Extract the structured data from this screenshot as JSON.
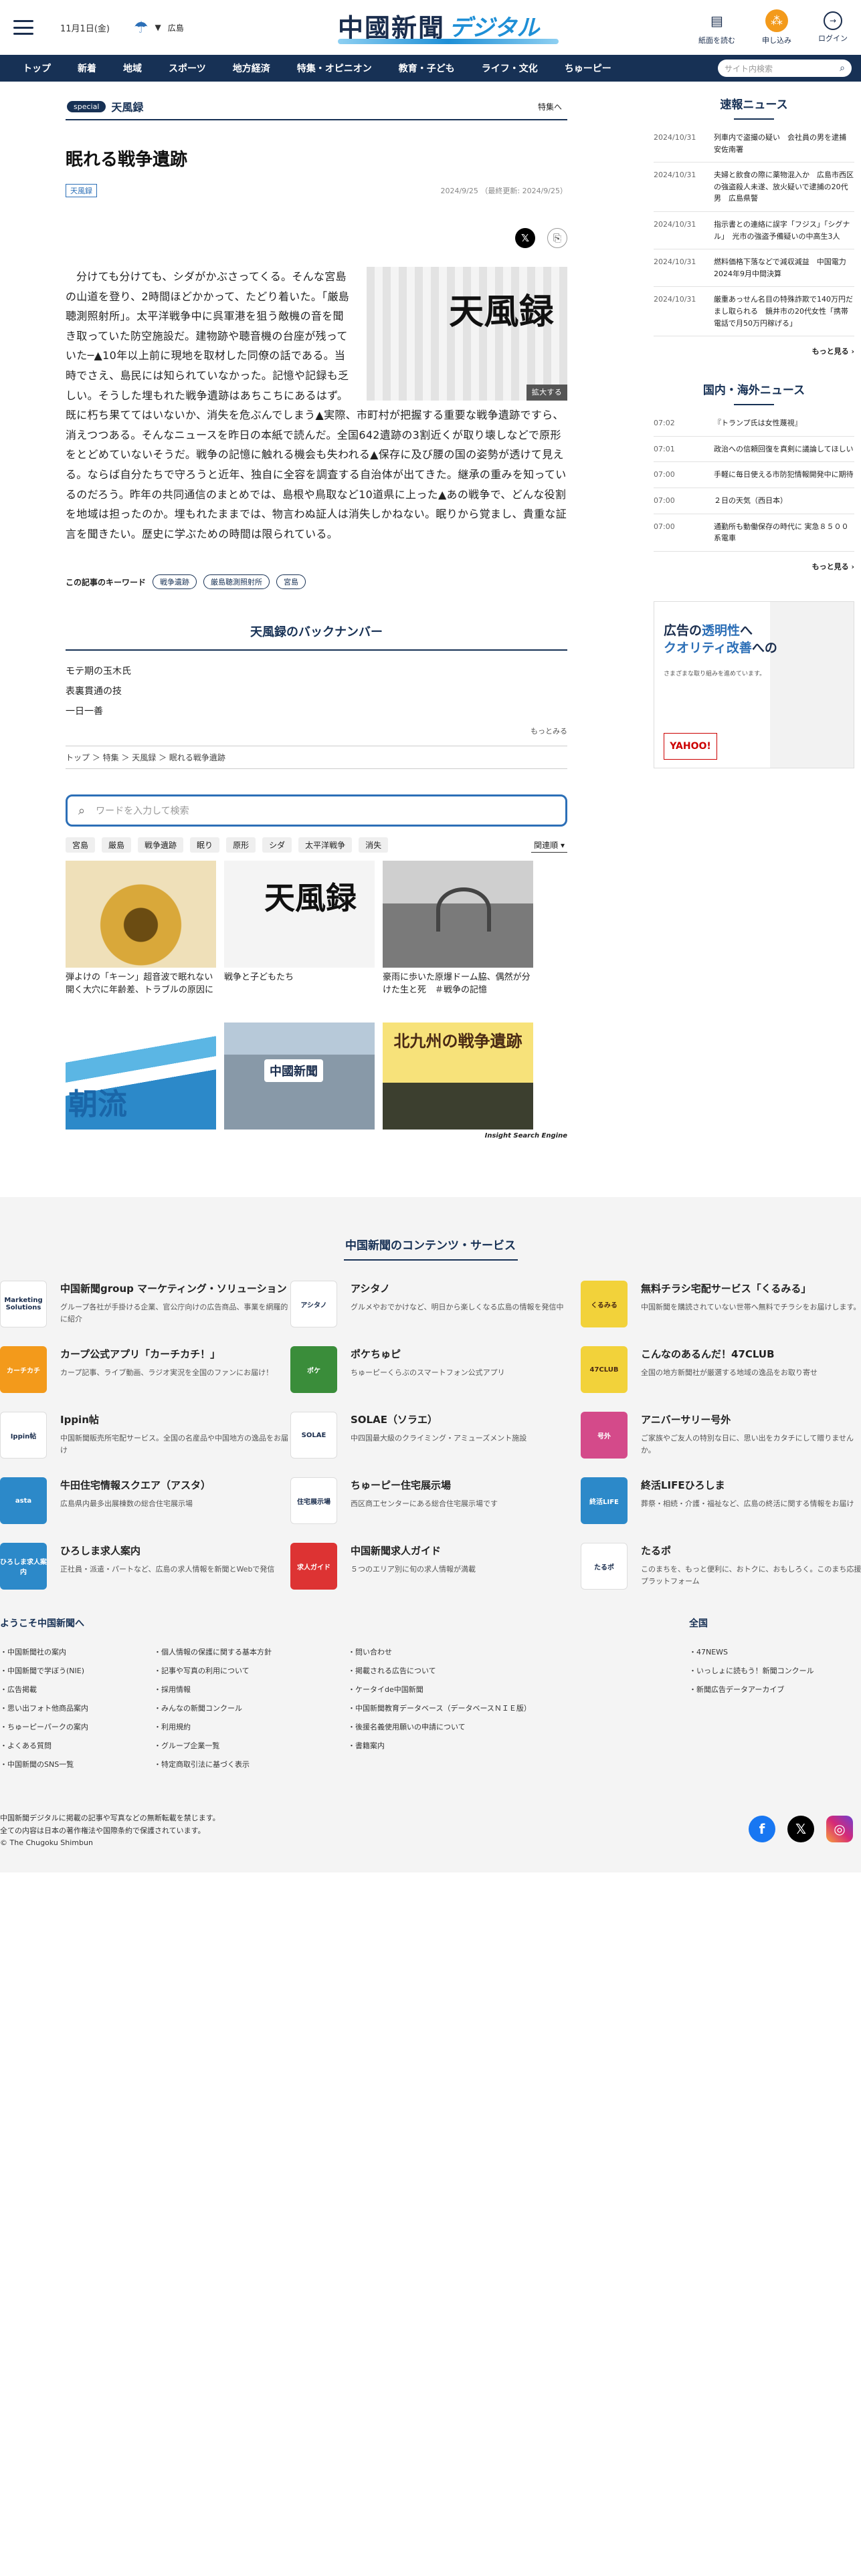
{
  "header": {
    "date": "11月1日(金)",
    "weather_region": "広島",
    "logo_main": "中國新聞",
    "logo_sub": "デジタル",
    "buttons": [
      "紙面を読む",
      "申し込み",
      "ログイン"
    ]
  },
  "nav": {
    "items": [
      "トップ",
      "新着",
      "地域",
      "スポーツ",
      "地方経済",
      "特集・オピニオン",
      "教育・子ども",
      "ライフ・文化",
      "ちゅーピー"
    ],
    "search_placeholder": "サイト内検索"
  },
  "section": {
    "badge": "special",
    "name": "天風録",
    "link": "特集へ"
  },
  "article": {
    "title": "眠れる戦争遺跡",
    "tag": "天風録",
    "dates": "2024/9/25 （最終更新: 2024/9/25）",
    "figure_text": "天風録",
    "figure_enlarge": "拡大する",
    "body": "分けても分けても、シダがかぶさってくる。そんな宮島の山道を登り、2時間ほどかかって、たどり着いた。「厳島聴測照射所」。太平洋戦争中に呉軍港を狙う敵機の音を聞き取っていた防空施設だ。建物跡や聴音機の台座が残っていた─▲10年以上前に現地を取材した同僚の話である。当時でさえ、島民には知られていなかった。記憶や記録も乏しい。そうした埋もれた戦争遺跡はあちこちにあるはず。既に朽ち果ててはいないか、消失を危ぶんでしまう▲実際、市町村が把握する重要な戦争遺跡ですら、消えつつある。そんなニュースを昨日の本紙で読んだ。全国642遺跡の3割近くが取り壊しなどで原形をとどめていないそうだ。戦争の記憶に触れる機会も失われる▲保存に及び腰の国の姿勢が透けて見える。ならば自分たちで守ろうと近年、独自に全容を調査する自治体が出てきた。継承の重みを知っているのだろう。昨年の共同通信のまとめでは、島根や鳥取など10道県に上った▲あの戦争で、どんな役割を地域は担ったのか。埋もれたままでは、物言わぬ証人は消失しかねない。眠りから覚まし、貴重な証言を聞きたい。歴史に学ぶための時間は限られている。",
    "keyword_label": "この記事のキーワード",
    "keywords": [
      "戦争遺跡",
      "厳島聴測照射所",
      "宮島"
    ]
  },
  "backnumber": {
    "title": "天風録のバックナンバー",
    "items": [
      "モテ期の玉木氏",
      "表裏貫通の技",
      "一日一善"
    ],
    "more": "もっとみる"
  },
  "breadcrumb": "トップ ＞ 特集 ＞ 天風録 ＞ 眠れる戦争遺跡",
  "search": {
    "placeholder": "ワードを入力して検索",
    "chips": [
      "宮島",
      "厳島",
      "戦争遺跡",
      "眠り",
      "原形",
      "シダ",
      "太平洋戦争",
      "消失"
    ],
    "sort": "関連順"
  },
  "related": [
    {
      "caption": "弾よけの「キーン」超音波で眠れない　開く大穴に年齢差、トラブルの原因に",
      "img": "img-tube"
    },
    {
      "caption": "戦争と子どもたち",
      "img": "img-text",
      "img_text": "天風録"
    },
    {
      "caption": "豪雨に歩いた原爆ドーム脇、偶然が分けた生と死　＃戦争の記憶",
      "img": "img-dome"
    },
    {
      "caption": "",
      "img": "img-wave",
      "img_text": "朝流"
    },
    {
      "caption": "",
      "img": "img-city",
      "img_text": "中國新聞"
    },
    {
      "caption": "",
      "img": "img-poster",
      "img_text": "北九州の戦争遺跡"
    }
  ],
  "ise": "Insight Search Engine",
  "sidebar": {
    "breaking_title": "速報ニュース",
    "breaking": [
      {
        "date": "2024/10/31",
        "text": "列車内で盗撮の疑い　会社員の男を逮捕　安佐南署"
      },
      {
        "date": "2024/10/31",
        "text": "夫婦と飲食の際に薬物混入か　広島市西区の強盗殺人未遂、放火疑いで逮捕の20代男　広島県警"
      },
      {
        "date": "2024/10/31",
        "text": "指示書との連絡に誤字「フジス」「シグナル」　光市の強盗予備疑いの中高生3人"
      },
      {
        "date": "2024/10/31",
        "text": "燃料価格下落などで減収減益　中国電力　2024年9月中間決算"
      },
      {
        "date": "2024/10/31",
        "text": "厳重あっせん名目の特殊詐欺で140万円だまし取られる　鏡井市の20代女性「携帯電話で月50万円稼げる」"
      }
    ],
    "more": "もっと見る",
    "world_title": "国内・海外ニュース",
    "world": [
      {
        "date": "07:02",
        "text": "『トランプ氏は女性蔑視』"
      },
      {
        "date": "07:01",
        "text": "政治への信頼回復を真剣に議論してほしい"
      },
      {
        "date": "07:00",
        "text": "手軽に毎日使える市防犯情報開発中に期待"
      },
      {
        "date": "07:00",
        "text": "２日の天気（西日本）"
      },
      {
        "date": "07:00",
        "text": "通勤所も動働保存の時代に 実急８５００系電車"
      }
    ],
    "ad": {
      "line1a": "広告の",
      "line1b": "透明性",
      "line1c": "へ",
      "line2a": "クオリティ",
      "line2b": "改善",
      "line2c": "への",
      "small": "さまざまな取り組みを進めています。",
      "logo": "YAHOO!"
    }
  },
  "footer": {
    "title": "中国新聞のコンテンツ・サービス",
    "services": [
      {
        "name": "中国新聞group マーケティング・ソリューション",
        "desc": "グループ各社が手掛ける企業、官公庁向けの広告商品、事業を網羅的に紹介",
        "logo": "Marketing Solutions",
        "cls": "lg-white"
      },
      {
        "name": "アシタノ",
        "desc": "グルメやおでかけなど、明日から楽しくなる広島の情報を発信中",
        "logo": "アシタノ",
        "cls": "lg-white"
      },
      {
        "name": "無料チラシ宅配サービス「くるみる」",
        "desc": "中国新聞を購読されていない世帯へ無料でチラシをお届けします。",
        "logo": "くるみる",
        "cls": "lg-yellow"
      },
      {
        "name": "カープ公式アプリ「カーチカチ！」",
        "desc": "カープ記事、ライブ動画、ラジオ実況を全国のファンにお届け！",
        "logo": "カーチカチ",
        "cls": "lg-orange"
      },
      {
        "name": "ポケちゅピ",
        "desc": "ちゅーピーくらぶのスマートフォン公式アプリ",
        "logo": "ポケ",
        "cls": "lg-green"
      },
      {
        "name": "こんなのあるんだ！47CLUB",
        "desc": "全国の地方新聞社が厳選する地域の逸品をお取り寄せ",
        "logo": "47CLUB",
        "cls": "lg-yellow"
      },
      {
        "name": "Ippin帖",
        "desc": "中国新聞販売所宅配サービス。全国の名産品や中国地方の逸品をお届け",
        "logo": "Ippin帖",
        "cls": "lg-white"
      },
      {
        "name": "SOLAE（ソラエ）",
        "desc": "中四国最大級のクライミング・アミューズメント施設",
        "logo": "SOLAE",
        "cls": "lg-white"
      },
      {
        "name": "アニバーサリー号外",
        "desc": "ご家族やご友人の特別な日に、思い出をカタチにして贈りませんか。",
        "logo": "号外",
        "cls": "lg-pink"
      },
      {
        "name": "牛田住宅情報スクエア（アスタ）",
        "desc": "広島県内最多出展棟数の総合住宅展示場",
        "logo": "asta",
        "cls": "lg-blue"
      },
      {
        "name": "ちゅーピー住宅展示場",
        "desc": "西区商工センターにある総合住宅展示場です",
        "logo": "住宅展示場",
        "cls": "lg-white"
      },
      {
        "name": "終活LIFEひろしま",
        "desc": "葬祭・相続・介護・福祉など、広島の終活に関する情報をお届け",
        "logo": "終活LIFE",
        "cls": "lg-blue"
      },
      {
        "name": "ひろしま求人案内",
        "desc": "正社員・派遣・パートなど、広島の求人情報を新聞とWebで発信",
        "logo": "ひろしま求人案内",
        "cls": "lg-blue"
      },
      {
        "name": "中国新聞求人ガイド",
        "desc": "５つのエリア別に旬の求人情報が満載",
        "logo": "求人ガイド",
        "cls": "lg-red"
      },
      {
        "name": "たるポ",
        "desc": "このまちを、もっと便利に、おトクに、おもしろく。このまち応援プラットフォーム",
        "logo": "たるポ",
        "cls": "lg-white"
      }
    ],
    "links_head": "ようこそ中国新聞へ",
    "links_col1": [
      "中国新聞社の案内",
      "中国新聞で学ぼう(NIE)",
      "広告掲載",
      "思い出フォト他商品案内",
      "ちゅーピーパークの案内",
      "よくある質問",
      "中国新聞のSNS一覧"
    ],
    "links_col2": [
      "個人情報の保護に関する基本方針",
      "記事や写真の利用について",
      "採用情報",
      "みんなの新聞コンクール",
      "利用規約",
      "グループ企業一覧",
      "特定商取引法に基づく表示"
    ],
    "links_col3": [
      "問い合わせ",
      "掲載される広告について",
      "ケータイde中国新聞",
      "中国新聞教育データベース（データベースＮＩＥ版）",
      "後援名義使用願いの申請について",
      "書籍案内"
    ],
    "links_head2": "全国",
    "links_col4": [
      "47NEWS",
      "いっしょに読もう！新聞コンクール",
      "新聞広告データアーカイブ"
    ],
    "copy1": "中国新聞デジタルに掲載の記事や写真などの無断転載を禁じます。",
    "copy2": "全ての内容は日本の著作権法や国際条約で保護されています。",
    "copy3": "© The Chugoku Shimbun"
  }
}
